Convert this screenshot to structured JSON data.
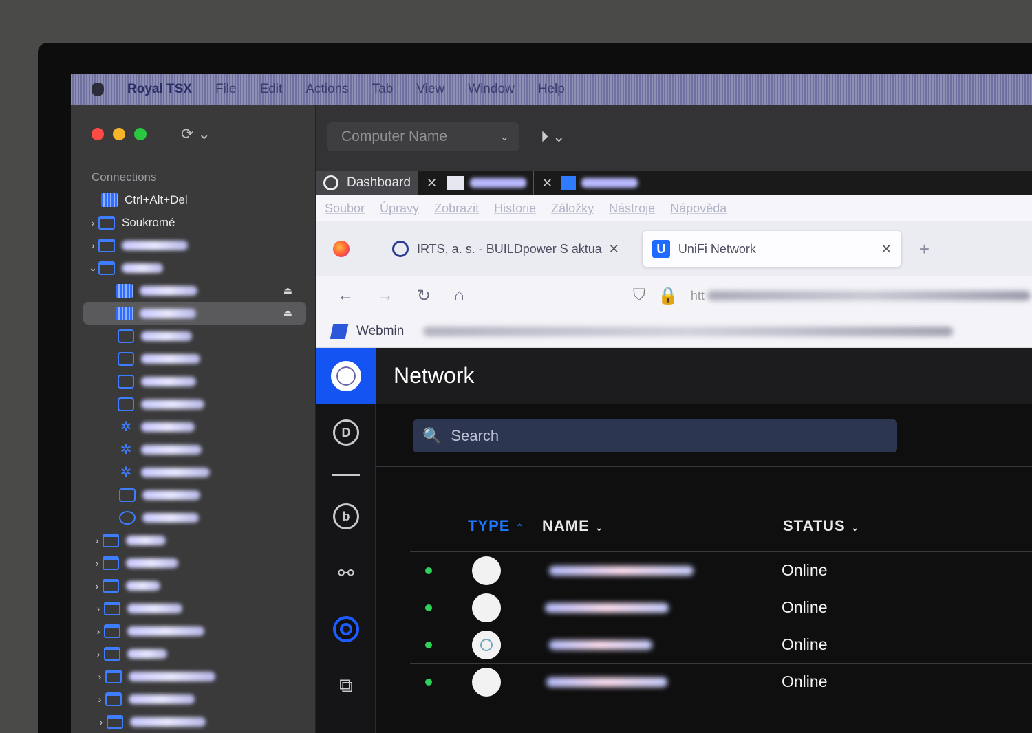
{
  "menubar": {
    "app_name": "Royal TSX",
    "items": [
      "File",
      "Edit",
      "Actions",
      "Tab",
      "View",
      "Window",
      "Help"
    ]
  },
  "sidebar": {
    "section_title": "Connections",
    "items": [
      {
        "label": "Ctrl+Alt+Del",
        "icon": "rdp-icon"
      },
      {
        "label": "Soukromé",
        "icon": "folder-icon"
      }
    ]
  },
  "toolbar": {
    "computer_name_placeholder": "Computer Name"
  },
  "royal_tabs": [
    {
      "label": "Dashboard",
      "icon": "dashboard-icon"
    }
  ],
  "firefox": {
    "menu": [
      "Soubor",
      "Úpravy",
      "Zobrazit",
      "Historie",
      "Záložky",
      "Nástroje",
      "Nápověda"
    ],
    "tabs": [
      {
        "label": "IRTS, a. s. - BUILDpower S aktua"
      },
      {
        "label": "UniFi Network"
      }
    ],
    "url_prefix": "htt",
    "bookmark": "Webmin"
  },
  "unifi": {
    "title": "Network",
    "search_placeholder": "Search",
    "columns": {
      "type": "TYPE",
      "name": "NAME",
      "status": "STATUS"
    },
    "rows": [
      {
        "status": "Online"
      },
      {
        "status": "Online"
      },
      {
        "status": "Online"
      },
      {
        "status": "Online"
      }
    ],
    "accent_color": "#1f76ff",
    "online_color": "#2ed15a"
  }
}
